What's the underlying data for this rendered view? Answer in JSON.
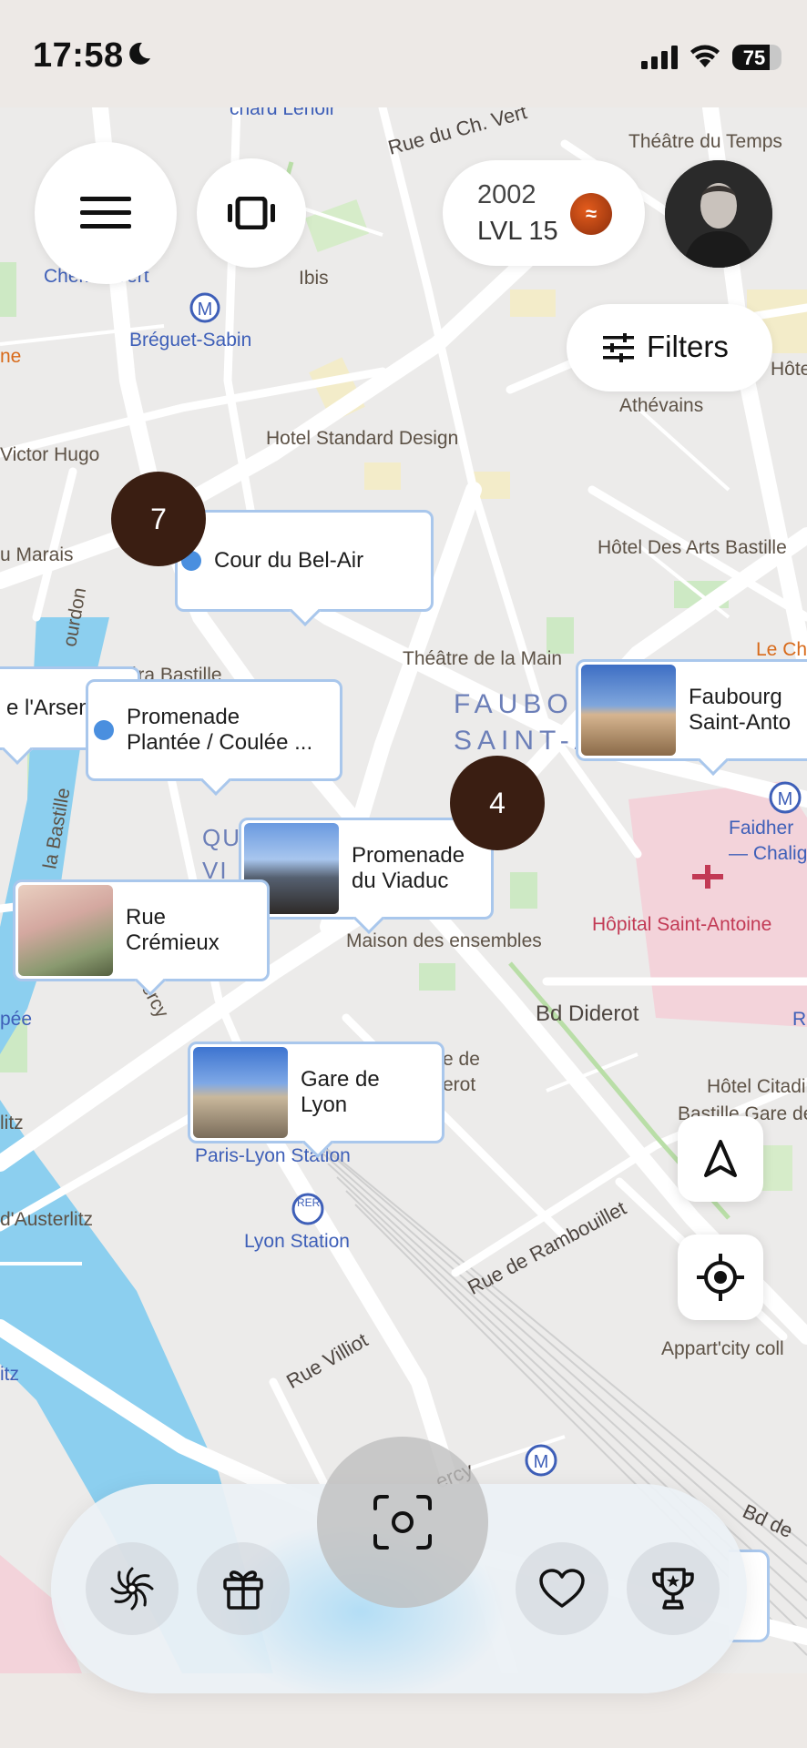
{
  "status": {
    "time": "17:58",
    "battery": "75",
    "battery_level": 0.75
  },
  "header": {
    "points": "2002",
    "level": "LVL 15",
    "filters_label": "Filters"
  },
  "clusters": [
    {
      "count": "7"
    },
    {
      "count": "4"
    }
  ],
  "places": [
    {
      "name": "Cour du Bel-Air"
    },
    {
      "name": "e l'Arsen"
    },
    {
      "name": "Promenade\nPlantée / Coulée ..."
    },
    {
      "name": "Faubourg\nSaint-Anto"
    },
    {
      "name": "Promenade\ndu Viaduc"
    },
    {
      "name": "Rue\nCrémieux"
    },
    {
      "name": "Gare de\nLyon"
    }
  ],
  "map_labels": {
    "rue_ch_vert": "Rue du Ch. Vert",
    "theatre_temps": "Théâtre du Temps",
    "lenoir": "chard Lenoir",
    "chemin_vert": "Chemin Vert",
    "ibis": "Ibis",
    "breguet": "Bréguet-Sabin",
    "hotel_standard": "Hotel Standard Design",
    "athevains": "Athévains",
    "hote": "Hôte",
    "victor_hugo": "Victor Hugo",
    "marais": "u Marais",
    "hotel_arts": "Hôtel Des Arts Bastille",
    "bourdon": "ourdon",
    "opera_bastille": "péra Bastille",
    "theatre_main": "Théâtre de la Main",
    "le_ch": "Le Ch",
    "faubourg_saint": "FAUBOURG\nSAINT-ANTOINE",
    "la_bastille": "la Bastille",
    "qu_vi": "QU\nVI",
    "faidher": "Faidher\n— Chalig",
    "hopital": "Hôpital Saint-Antoine",
    "maison": "Maison des ensembles",
    "bd_diderot": "Bd Diderot",
    "e_de_erot": "e de\nerot",
    "hotel_citadines": "Hôtel Citadine",
    "bastille_gare": "Bastille Gare de",
    "pee": "pée",
    "bercy": "de Bercy",
    "litz": "litz",
    "austerlitz": "d'Austerlitz",
    "paris_lyon": "Paris-Lyon Station",
    "rer": "RER",
    "lyon_station": "Lyon Station",
    "rue_rambouillet": "Rue de Rambouillet",
    "rue_villiot": "Rue Villiot",
    "appart_city": "Appart'city coll",
    "itz": "itz",
    "ercy": "ercy",
    "bd_de": "Bd de",
    "ne": "ne",
    "r": "R",
    "m": "M"
  }
}
